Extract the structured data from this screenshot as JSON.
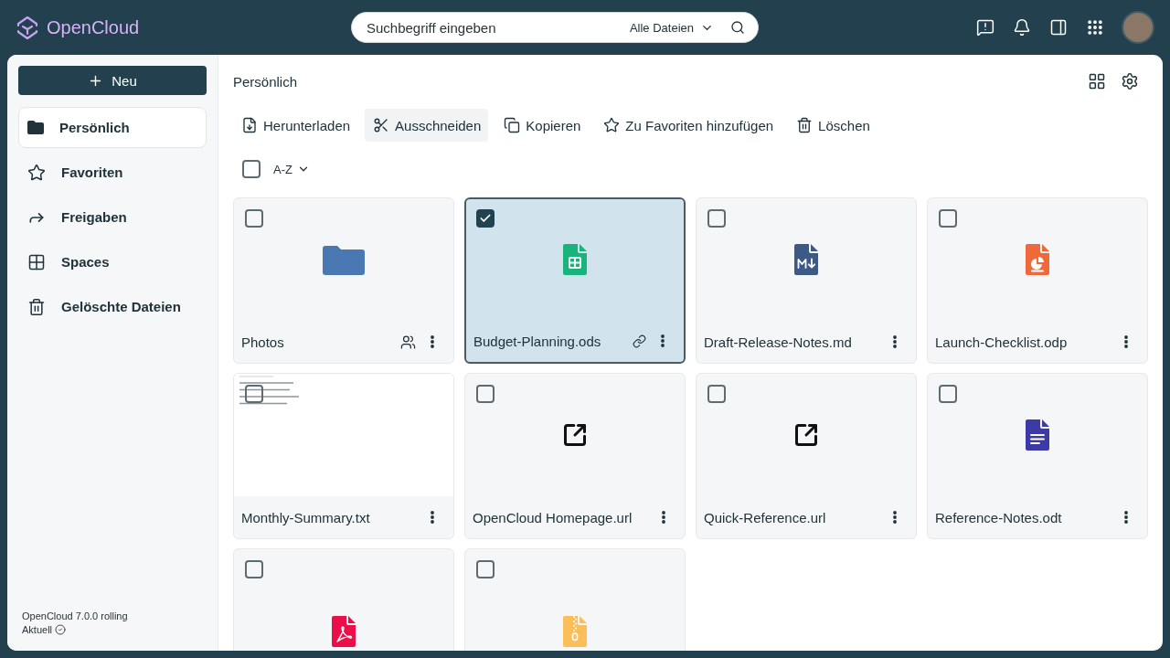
{
  "header": {
    "logo": "OpenCloud",
    "search": {
      "placeholder": "Suchbegriff eingeben",
      "scope": "Alle Dateien"
    }
  },
  "sidebar": {
    "new_button": "Neu",
    "items": [
      {
        "label": "Persönlich",
        "selected": true
      },
      {
        "label": "Favoriten",
        "selected": false
      },
      {
        "label": "Freigaben",
        "selected": false
      },
      {
        "label": "Spaces",
        "selected": false
      },
      {
        "label": "Gelöschte Dateien",
        "selected": false
      }
    ],
    "version": "OpenCloud 7.0.0 rolling",
    "status": "Aktuell"
  },
  "breadcrumb": "Persönlich",
  "actions": [
    {
      "label": "Herunterladen",
      "hovered": false
    },
    {
      "label": "Ausschneiden",
      "hovered": true
    },
    {
      "label": "Kopieren",
      "hovered": false
    },
    {
      "label": "Zu Favoriten hinzufügen",
      "hovered": false
    },
    {
      "label": "Löschen",
      "hovered": false
    }
  ],
  "select_all": {
    "checked": false
  },
  "sort": {
    "label": "A-Z"
  },
  "files": [
    {
      "name": "Photos",
      "kind": "folder",
      "selected": false,
      "shared": true,
      "link": false
    },
    {
      "name": "Budget-Planning.ods",
      "kind": "spreadsheet",
      "selected": true,
      "shared": false,
      "link": true
    },
    {
      "name": "Draft-Release-Notes.md",
      "kind": "markdown",
      "selected": false,
      "shared": false,
      "link": false
    },
    {
      "name": "Launch-Checklist.odp",
      "kind": "presentation",
      "selected": false,
      "shared": false,
      "link": false
    },
    {
      "name": "Monthly-Summary.txt",
      "kind": "text",
      "selected": false,
      "shared": false,
      "link": false
    },
    {
      "name": "OpenCloud Homepage.url",
      "kind": "url",
      "selected": false,
      "shared": false,
      "link": false
    },
    {
      "name": "Quick-Reference.url",
      "kind": "url",
      "selected": false,
      "shared": false,
      "link": false
    },
    {
      "name": "Reference-Notes.odt",
      "kind": "document",
      "selected": false,
      "shared": false,
      "link": false
    },
    {
      "kind": "pdf",
      "selected": false,
      "shared": false,
      "link": false
    },
    {
      "kind": "archive",
      "selected": false,
      "shared": false,
      "link": false
    }
  ]
}
